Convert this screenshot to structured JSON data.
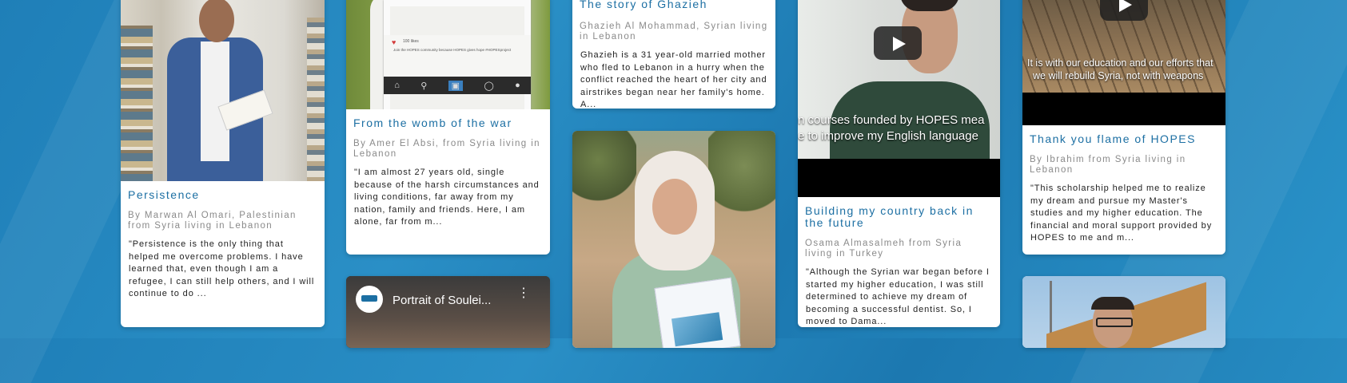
{
  "cards": {
    "persistence": {
      "title": "Persistence",
      "byline": "By Marwan Al Omari, Palestinian from Syria living in Lebanon",
      "excerpt": "\"Persistence is the only thing that helped me overcome problems. I have learned that, even though I am a refugee, I can still help others, and I will continue to do ..."
    },
    "womb": {
      "title": "From the womb of the war",
      "byline": "By Amer El Absi, from Syria living in Lebanon",
      "excerpt": "\"I am almost 27 years old, single because of the harsh circumstances and living conditions, far away from my nation, family and friends. Here, I am alone, far from m...",
      "frame_likes": "100 likes",
      "frame_caption": "Join the HOPES community because HOPES gives hope #HOPESproject"
    },
    "ghazieh": {
      "title": "The story of Ghazieh",
      "byline": "Ghazieh Al Mohammad, Syrian living in Lebanon",
      "excerpt": "Ghazieh is a 31 year-old married mother who fled to Lebanon in a hurry when the conflict reached the heart of her city and airstrikes began near her family's home. A..."
    },
    "building": {
      "title": "Building my country back in the future",
      "byline": "Osama Almasalmeh from Syria living in Turkey",
      "excerpt": "\"Although the Syrian war began before I started my higher education, I was still determined to achieve my dream of becoming a successful dentist. So, I moved to Dama...",
      "subtitle_line1": "n courses founded by HOPES mea",
      "subtitle_line2": "e to improve my English language"
    },
    "flame": {
      "title": "Thank you flame of HOPES",
      "byline": "By Ibrahim from Syria living in Lebanon",
      "excerpt": "\"This scholarship helped me to realize my dream and pursue my Master's studies and my higher education. The financial and moral support provided by HOPES to me and m...",
      "subtitle_line1": "It is with our education and our efforts that",
      "subtitle_line2": "we will rebuild Syria, not with weapons"
    },
    "soulei": {
      "video_title": "Portrait of Soulei..."
    }
  },
  "colors": {
    "accent": "#1c6fa3",
    "background": "#2a8fc6"
  }
}
